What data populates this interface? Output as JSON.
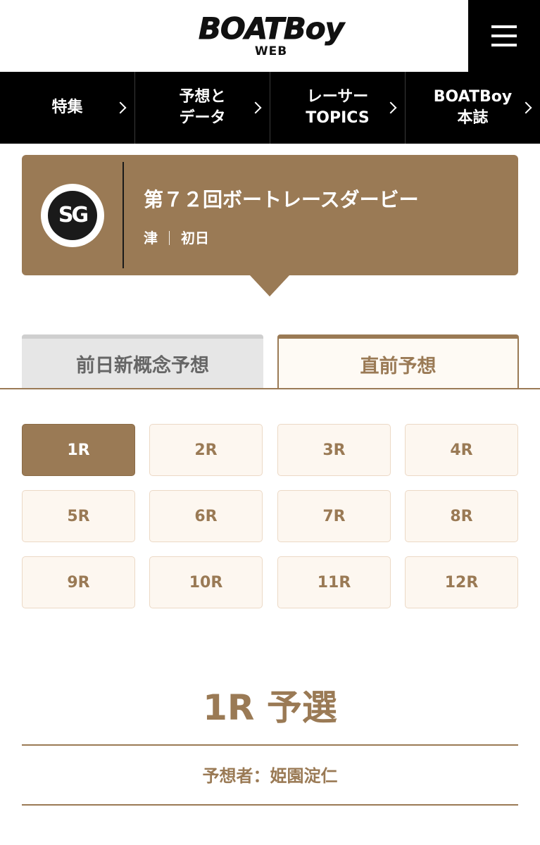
{
  "header": {
    "logo_main": "BOATBoy",
    "logo_sub": "WEB"
  },
  "nav": {
    "items": [
      {
        "label": "特集"
      },
      {
        "label": "予想と\nデータ"
      },
      {
        "label": "レーサー\nTOPICS"
      },
      {
        "label": "BOATBoy\n本誌"
      }
    ]
  },
  "race": {
    "grade_badge": "SG",
    "title": "第７２回ボートレースダービー",
    "venue": "津",
    "day": "初日"
  },
  "tabs": {
    "items": [
      {
        "label": "前日新概念予想",
        "selected": false
      },
      {
        "label": "直前予想",
        "selected": true
      }
    ]
  },
  "race_buttons": {
    "items": [
      {
        "label": "1R",
        "selected": true
      },
      {
        "label": "2R"
      },
      {
        "label": "3R"
      },
      {
        "label": "4R"
      },
      {
        "label": "5R"
      },
      {
        "label": "6R"
      },
      {
        "label": "7R"
      },
      {
        "label": "8R"
      },
      {
        "label": "9R"
      },
      {
        "label": "10R"
      },
      {
        "label": "11R"
      },
      {
        "label": "12R"
      }
    ]
  },
  "section": {
    "heading": "1R 予選",
    "predictor": "予想者：姫園淀仁"
  },
  "colors": {
    "accent": "#9a7a55",
    "nav_bg": "#000000",
    "race_btn_bg": "#fdf7f0"
  }
}
